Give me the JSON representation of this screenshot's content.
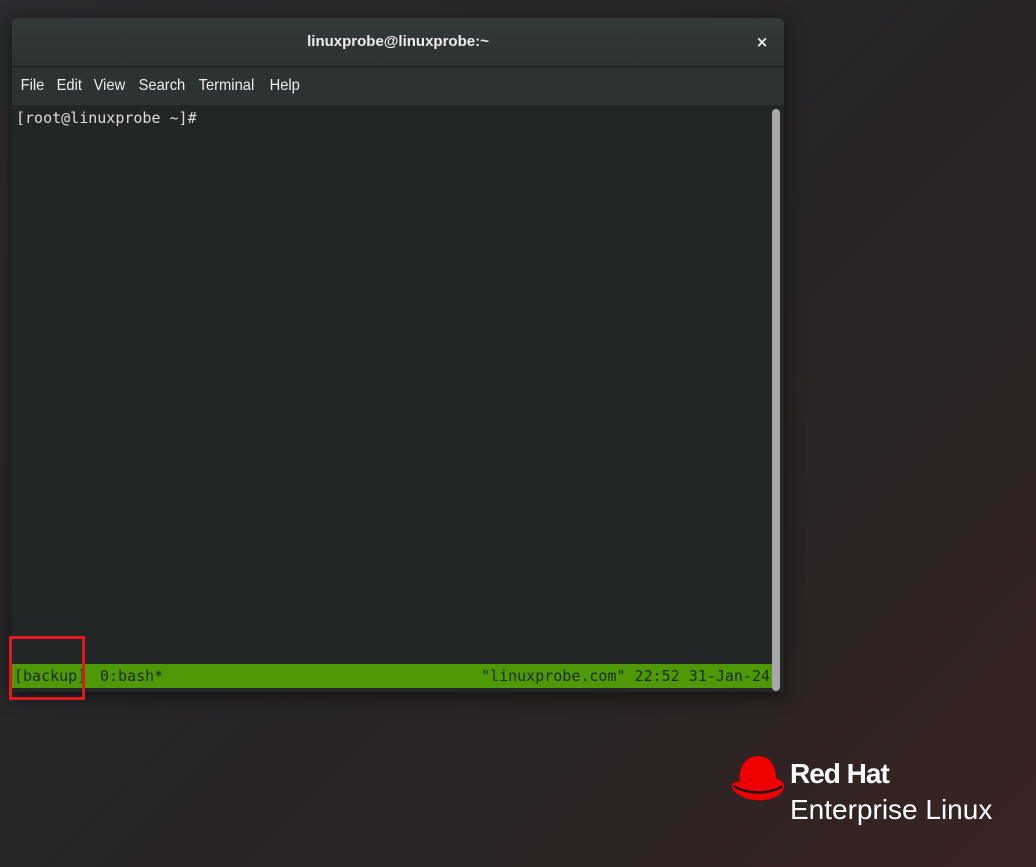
{
  "window": {
    "title": "linuxprobe@linuxprobe:~",
    "close_label": "×"
  },
  "menubar": {
    "items": [
      {
        "label": "File"
      },
      {
        "label": "Edit"
      },
      {
        "label": "View"
      },
      {
        "label": "Search"
      },
      {
        "label": "Terminal"
      },
      {
        "label": "Help"
      }
    ]
  },
  "terminal": {
    "prompt": "[root@linuxprobe ~]#"
  },
  "tmux_status": {
    "session": "[backup]",
    "window": "0:bash*",
    "right": "\"linuxprobe.com\" 22:52 31-Jan-24"
  },
  "brand": {
    "line1": "Red Hat",
    "line2": "Enterprise Linux"
  },
  "colors": {
    "status_bar": "#4e9a06",
    "highlight_box": "#e0191c",
    "brand_red": "#ee0000"
  }
}
